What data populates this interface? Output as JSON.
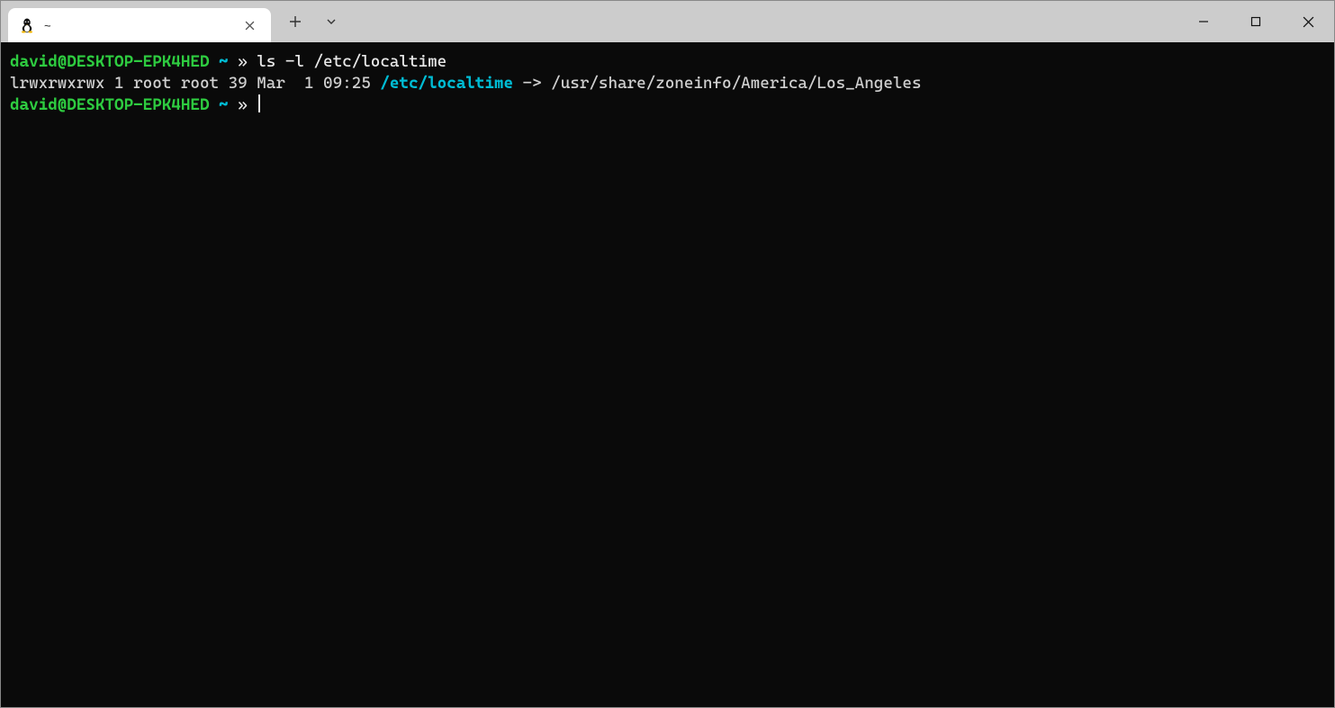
{
  "titlebar": {
    "tab": {
      "title": "~"
    }
  },
  "terminal": {
    "line1": {
      "userhost": "david@DESKTOP-EPK4HED",
      "cwd": " ~ ",
      "promptchar": "» ",
      "command": "ls -l /etc/localtime"
    },
    "line2": {
      "perms": "lrwxrwxrwx 1 root root 39 Mar  1 09:25 ",
      "linkname": "/etc/localtime",
      "arrow": " -> ",
      "target": "/usr/share/zoneinfo/America/Los_Angeles"
    },
    "line3": {
      "userhost": "david@DESKTOP-EPK4HED",
      "cwd": " ~ ",
      "promptchar": "» "
    }
  }
}
